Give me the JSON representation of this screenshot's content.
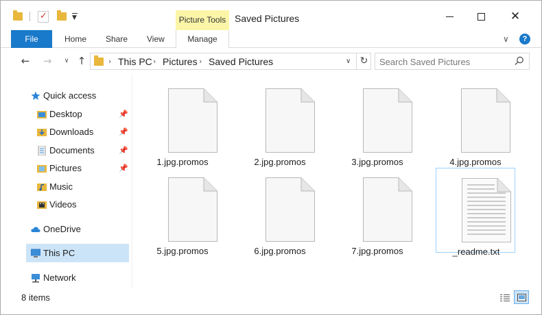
{
  "titlebar": {
    "context_tab": "Picture Tools",
    "title": "Saved Pictures"
  },
  "ribbon": {
    "tabs": [
      {
        "label": "File"
      },
      {
        "label": "Home"
      },
      {
        "label": "Share"
      },
      {
        "label": "View"
      },
      {
        "label": "Manage"
      }
    ]
  },
  "address": {
    "crumbs": [
      "This PC",
      "Pictures",
      "Saved Pictures"
    ],
    "search_placeholder": "Search Saved Pictures"
  },
  "navpane": {
    "quick_access": "Quick access",
    "items": [
      {
        "label": "Desktop",
        "icon": "desktop-icon",
        "pinned": true
      },
      {
        "label": "Downloads",
        "icon": "downloads-icon",
        "pinned": true
      },
      {
        "label": "Documents",
        "icon": "documents-icon",
        "pinned": true
      },
      {
        "label": "Pictures",
        "icon": "pictures-icon",
        "pinned": true
      },
      {
        "label": "Music",
        "icon": "music-icon",
        "pinned": false
      },
      {
        "label": "Videos",
        "icon": "videos-icon",
        "pinned": false
      }
    ],
    "onedrive": "OneDrive",
    "this_pc": "This PC",
    "network": "Network"
  },
  "files": [
    {
      "name": "1.jpg.promos",
      "type": "blank"
    },
    {
      "name": "2.jpg.promos",
      "type": "blank"
    },
    {
      "name": "3.jpg.promos",
      "type": "blank"
    },
    {
      "name": "4.jpg.promos",
      "type": "blank"
    },
    {
      "name": "5.jpg.promos",
      "type": "blank"
    },
    {
      "name": "6.jpg.promos",
      "type": "blank"
    },
    {
      "name": "7.jpg.promos",
      "type": "blank"
    },
    {
      "name": "_readme.txt",
      "type": "text"
    }
  ],
  "status": {
    "count": "8 items"
  },
  "colors": {
    "accent": "#1979ca",
    "context_tab_bg": "#fbf5a8",
    "selected_bg": "#cce4f7",
    "folder": "#e8b73c"
  }
}
